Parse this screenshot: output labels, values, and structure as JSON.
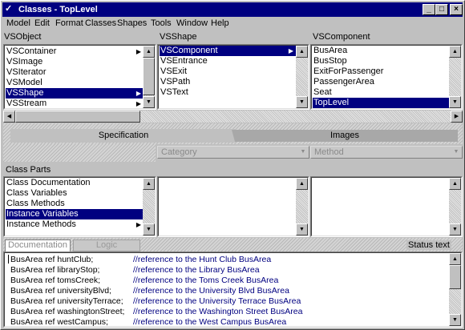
{
  "window": {
    "title": "Classes - TopLevel",
    "controls": {
      "minimize": "_",
      "maximize": "□",
      "close": "×"
    }
  },
  "menu": [
    "Model",
    "Edit",
    "Format",
    "Classes",
    "Shapes",
    "Tools",
    "Window",
    "Help"
  ],
  "panes": {
    "objects": {
      "header": "VSObject",
      "items": [
        "VSContainer",
        "VSImage",
        "VSIterator",
        "VSModel",
        "VSShape",
        "VSStream"
      ],
      "arrows": [
        true,
        false,
        false,
        false,
        true,
        true
      ],
      "selected": 4
    },
    "shapes": {
      "header": "VSShape",
      "items": [
        "VSComponent",
        "VSEntrance",
        "VSExit",
        "VSPath",
        "VSText"
      ],
      "arrows": [
        true,
        false,
        false,
        false,
        false
      ],
      "selected": 0
    },
    "components": {
      "header": "VSComponent",
      "items": [
        "BusArea",
        "BusStop",
        "ExitForPassenger",
        "PassengerArea",
        "Seat",
        "TopLevel"
      ],
      "selected": 5
    }
  },
  "tabs": {
    "specification": "Specification",
    "images": "Images"
  },
  "combos": {
    "category": "Category",
    "method": "Method"
  },
  "class_parts": {
    "header": "Class Parts",
    "items": [
      "Class Documentation",
      "Class Variables",
      "Class Methods",
      "Instance Variables",
      "Instance Methods"
    ],
    "arrows": [
      false,
      false,
      false,
      false,
      true
    ],
    "selected": 3
  },
  "bottom_tabs": {
    "documentation": "Documentation",
    "logic": "Logic"
  },
  "status_text": "Status text",
  "code_lines": [
    {
      "decl": "BusArea ref  huntClub;",
      "comment": "//reference to the Hunt Club BusArea"
    },
    {
      "decl": "BusArea ref  libraryStop;",
      "comment": "//reference to the Library BusArea"
    },
    {
      "decl": "BusArea ref  tomsCreek;",
      "comment": "//reference to the Toms Creek BusArea"
    },
    {
      "decl": "BusArea ref  universityBlvd;",
      "comment": "//reference to the University Blvd BusArea"
    },
    {
      "decl": "BusArea ref  universityTerrace;",
      "comment": "//reference to the University Terrace BusArea"
    },
    {
      "decl": "BusArea ref  washingtonStreet;",
      "comment": "//reference to the Washington Street BusArea"
    },
    {
      "decl": "BusArea ref  westCampus;",
      "comment": "//reference to the West Campus BusArea"
    }
  ]
}
